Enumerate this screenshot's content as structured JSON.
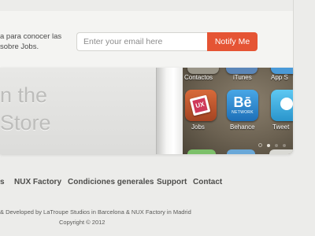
{
  "signup": {
    "line1": "a para conocer las",
    "line2": "sobre Jobs.",
    "email_placeholder": "Enter your email here",
    "button_label": "Notify Me"
  },
  "hero": {
    "line1": "n the",
    "line2": "Store",
    "apps_row1": [
      "Contactos",
      "iTunes",
      "App S"
    ],
    "apps_row2": [
      "Jobs",
      "Behance",
      "Tweet"
    ],
    "jobs_icon_text": "UX",
    "behance_icon_text": "Bē",
    "behance_icon_subtext": "NETWORK"
  },
  "footer": {
    "nav": [
      "s",
      "NUX Factory",
      "Condiciones generales",
      "Support",
      "Contact"
    ],
    "credit": "& Developed by LaTroupe Studios in Barcelona & NUX Factory in Madrid",
    "copyright": "Copyright © 2012"
  },
  "colors": {
    "accent": "#e55434",
    "background": "#ececea"
  }
}
